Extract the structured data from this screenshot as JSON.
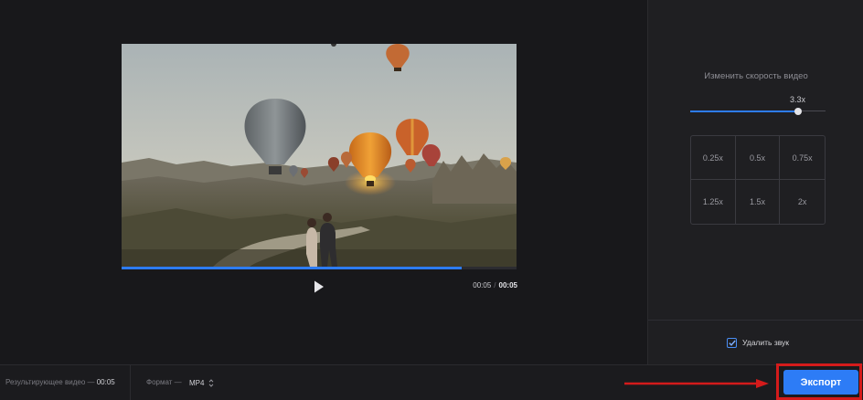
{
  "player": {
    "progress_fraction": 0.86,
    "current_time": "00:05",
    "separator": "/",
    "total_time": "00:05",
    "play_icon": "play-icon"
  },
  "speed_panel": {
    "title": "Изменить скорость видео",
    "current_value": "3.3x",
    "slider_fraction": 0.8,
    "presets": [
      "0.25x",
      "0.5x",
      "0.75x",
      "1.25x",
      "1.5x",
      "2x"
    ]
  },
  "mute": {
    "label": "Удалить звук",
    "checked": true
  },
  "footer": {
    "result_label": "Результирующее видео —",
    "result_duration": "00:05",
    "format_label": "Формат —",
    "format_value": "MP4",
    "export_label": "Экспорт"
  },
  "colors": {
    "accent": "#2d7cf6",
    "highlight": "#d41b1b",
    "background": "#18181b"
  }
}
